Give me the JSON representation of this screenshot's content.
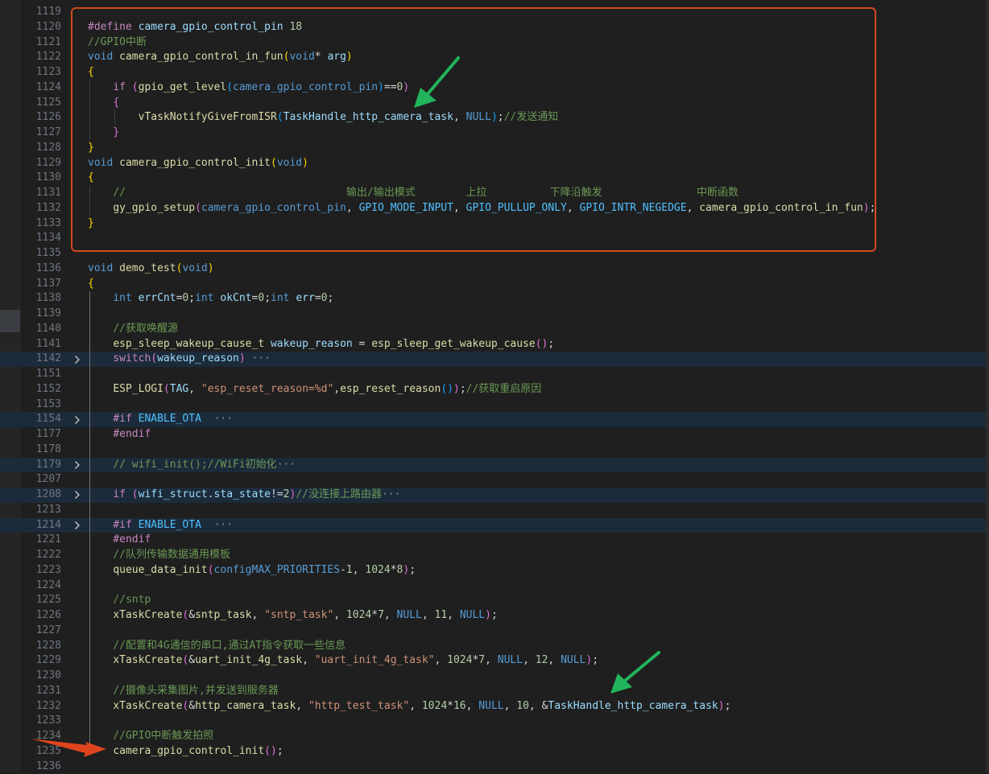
{
  "editor": {
    "language": "c",
    "highlight_box_color": "#d04a1e",
    "arrow_colors": {
      "green": "#22b45c",
      "red": "#e0441c"
    },
    "lines": [
      {
        "n": "1119",
        "tokens": []
      },
      {
        "n": "1120",
        "tokens": [
          {
            "t": "#define",
            "c": "kc"
          },
          {
            "t": " camera_gpio_control_pin ",
            "c": "v"
          },
          {
            "t": "18",
            "c": "n"
          }
        ]
      },
      {
        "n": "1121",
        "tokens": [
          {
            "t": "//GPIO中断",
            "c": "c"
          }
        ]
      },
      {
        "n": "1122",
        "tokens": [
          {
            "t": "void",
            "c": "k"
          },
          {
            "t": " "
          },
          {
            "t": "camera_gpio_control_in_fun",
            "c": "fn"
          },
          {
            "t": "(",
            "c": "b1"
          },
          {
            "t": "void",
            "c": "k"
          },
          {
            "t": "* "
          },
          {
            "t": "arg",
            "c": "v"
          },
          {
            "t": ")",
            "c": "b1"
          }
        ]
      },
      {
        "n": "1123",
        "tokens": [
          {
            "t": "{",
            "c": "b1"
          }
        ]
      },
      {
        "n": "1124",
        "tokens": [
          {
            "t": "    "
          },
          {
            "t": "if",
            "c": "kc"
          },
          {
            "t": " "
          },
          {
            "t": "(",
            "c": "b2"
          },
          {
            "t": "gpio_get_level",
            "c": "fn"
          },
          {
            "t": "(",
            "c": "b3"
          },
          {
            "t": "camera_gpio_control_pin",
            "c": "k"
          },
          {
            "t": ")",
            "c": "b3"
          },
          {
            "t": "=="
          },
          {
            "t": "0",
            "c": "n"
          },
          {
            "t": ")",
            "c": "b2"
          }
        ]
      },
      {
        "n": "1125",
        "tokens": [
          {
            "t": "    "
          },
          {
            "t": "{",
            "c": "b2"
          }
        ]
      },
      {
        "n": "1126",
        "tokens": [
          {
            "t": "        "
          },
          {
            "t": "vTaskNotifyGiveFromISR",
            "c": "fn"
          },
          {
            "t": "(",
            "c": "b3"
          },
          {
            "t": "TaskHandle_http_camera_task",
            "c": "v"
          },
          {
            "t": ", "
          },
          {
            "t": "NULL",
            "c": "k"
          },
          {
            "t": ")",
            "c": "b3"
          },
          {
            "t": ";"
          },
          {
            "t": "//发送通知",
            "c": "c"
          }
        ]
      },
      {
        "n": "1127",
        "tokens": [
          {
            "t": "    "
          },
          {
            "t": "}",
            "c": "b2"
          }
        ]
      },
      {
        "n": "1128",
        "tokens": [
          {
            "t": "}",
            "c": "b1"
          }
        ]
      },
      {
        "n": "1129",
        "tokens": [
          {
            "t": "void",
            "c": "k"
          },
          {
            "t": " "
          },
          {
            "t": "camera_gpio_control_init",
            "c": "fn"
          },
          {
            "t": "(",
            "c": "b1"
          },
          {
            "t": "void",
            "c": "k"
          },
          {
            "t": ")",
            "c": "b1"
          }
        ]
      },
      {
        "n": "1130",
        "tokens": [
          {
            "t": "{",
            "c": "b1"
          }
        ]
      },
      {
        "n": "1131",
        "tokens": [
          {
            "t": "    "
          },
          {
            "t": "//                                   输出/输出模式        上拉          下降沿触发               中断函数",
            "c": "c"
          }
        ]
      },
      {
        "n": "1132",
        "tokens": [
          {
            "t": "    "
          },
          {
            "t": "gy_gpio_setup",
            "c": "fn"
          },
          {
            "t": "(",
            "c": "b2"
          },
          {
            "t": "camera_gpio_control_pin",
            "c": "k"
          },
          {
            "t": ", "
          },
          {
            "t": "GPIO_MODE_INPUT",
            "c": "m"
          },
          {
            "t": ", "
          },
          {
            "t": "GPIO_PULLUP_ONLY",
            "c": "m"
          },
          {
            "t": ", "
          },
          {
            "t": "GPIO_INTR_NEGEDGE",
            "c": "m"
          },
          {
            "t": ", "
          },
          {
            "t": "camera_gpio_control_in_fun",
            "c": "fn"
          },
          {
            "t": ")",
            "c": "b2"
          },
          {
            "t": ";"
          }
        ]
      },
      {
        "n": "1133",
        "tokens": [
          {
            "t": "}",
            "c": "b1"
          }
        ]
      },
      {
        "n": "1134",
        "tokens": []
      },
      {
        "n": "1135",
        "tokens": []
      },
      {
        "n": "1136",
        "tokens": [
          {
            "t": "void",
            "c": "k"
          },
          {
            "t": " "
          },
          {
            "t": "demo_test",
            "c": "fn"
          },
          {
            "t": "(",
            "c": "b1"
          },
          {
            "t": "void",
            "c": "k"
          },
          {
            "t": ")",
            "c": "b1"
          }
        ]
      },
      {
        "n": "1137",
        "tokens": [
          {
            "t": "{",
            "c": "b1"
          }
        ]
      },
      {
        "n": "1138",
        "tokens": [
          {
            "t": "    "
          },
          {
            "t": "int",
            "c": "k"
          },
          {
            "t": " "
          },
          {
            "t": "errCnt",
            "c": "v"
          },
          {
            "t": "="
          },
          {
            "t": "0",
            "c": "n"
          },
          {
            "t": ";"
          },
          {
            "t": "int",
            "c": "k"
          },
          {
            "t": " "
          },
          {
            "t": "okCnt",
            "c": "v"
          },
          {
            "t": "="
          },
          {
            "t": "0",
            "c": "n"
          },
          {
            "t": ";"
          },
          {
            "t": "int",
            "c": "k"
          },
          {
            "t": " "
          },
          {
            "t": "err",
            "c": "v"
          },
          {
            "t": "="
          },
          {
            "t": "0",
            "c": "n"
          },
          {
            "t": ";"
          }
        ]
      },
      {
        "n": "1139",
        "tokens": []
      },
      {
        "n": "1140",
        "tokens": [
          {
            "t": "    "
          },
          {
            "t": "//获取唤醒源",
            "c": "c"
          }
        ]
      },
      {
        "n": "1141",
        "tokens": [
          {
            "t": "    "
          },
          {
            "t": "esp_sleep_wakeup_cause_t",
            "c": "fn"
          },
          {
            "t": " "
          },
          {
            "t": "wakeup_reason",
            "c": "v"
          },
          {
            "t": " = "
          },
          {
            "t": "esp_sleep_get_wakeup_cause",
            "c": "fn"
          },
          {
            "t": "(",
            "c": "b2"
          },
          {
            "t": ")",
            "c": "b2"
          },
          {
            "t": ";"
          }
        ]
      },
      {
        "n": "1142",
        "fold": true,
        "tokens": [
          {
            "t": "    "
          },
          {
            "t": "switch",
            "c": "kc"
          },
          {
            "t": "(",
            "c": "b2"
          },
          {
            "t": "wakeup_reason",
            "c": "v"
          },
          {
            "t": ")",
            "c": "b2"
          },
          {
            "t": " "
          },
          {
            "t": "···",
            "c": "el"
          }
        ]
      },
      {
        "n": "1151",
        "tokens": []
      },
      {
        "n": "1152",
        "tokens": [
          {
            "t": "    "
          },
          {
            "t": "ESP_LOGI",
            "c": "fn"
          },
          {
            "t": "(",
            "c": "b2"
          },
          {
            "t": "TAG",
            "c": "v"
          },
          {
            "t": ", "
          },
          {
            "t": "\"esp_reset_reason=%d\"",
            "c": "s"
          },
          {
            "t": ","
          },
          {
            "t": "esp_reset_reason",
            "c": "fn"
          },
          {
            "t": "(",
            "c": "b3"
          },
          {
            "t": ")",
            "c": "b3"
          },
          {
            "t": ")",
            "c": "b2"
          },
          {
            "t": ";"
          },
          {
            "t": "//获取重启原因",
            "c": "c"
          }
        ]
      },
      {
        "n": "1153",
        "tokens": []
      },
      {
        "n": "1154",
        "fold": true,
        "tokens": [
          {
            "t": "    "
          },
          {
            "t": "#if",
            "c": "kc"
          },
          {
            "t": " "
          },
          {
            "t": "ENABLE_OTA",
            "c": "m"
          },
          {
            "t": "  "
          },
          {
            "t": "···",
            "c": "el"
          }
        ]
      },
      {
        "n": "1177",
        "tokens": [
          {
            "t": "    "
          },
          {
            "t": "#endif",
            "c": "kc"
          }
        ]
      },
      {
        "n": "1178",
        "tokens": []
      },
      {
        "n": "1179",
        "fold": true,
        "tokens": [
          {
            "t": "    "
          },
          {
            "t": "// wifi_init();//WiFi初始化",
            "c": "c"
          },
          {
            "t": "···",
            "c": "el"
          }
        ]
      },
      {
        "n": "1207",
        "tokens": []
      },
      {
        "n": "1208",
        "fold": true,
        "tokens": [
          {
            "t": "    "
          },
          {
            "t": "if",
            "c": "kc"
          },
          {
            "t": " "
          },
          {
            "t": "(",
            "c": "b2"
          },
          {
            "t": "wifi_struct",
            "c": "v"
          },
          {
            "t": "."
          },
          {
            "t": "sta_state",
            "c": "v"
          },
          {
            "t": "!="
          },
          {
            "t": "2",
            "c": "n"
          },
          {
            "t": ")",
            "c": "b2"
          },
          {
            "t": "//没连接上路由器",
            "c": "c"
          },
          {
            "t": "···",
            "c": "el"
          }
        ]
      },
      {
        "n": "1213",
        "tokens": []
      },
      {
        "n": "1214",
        "fold": true,
        "tokens": [
          {
            "t": "    "
          },
          {
            "t": "#if",
            "c": "kc"
          },
          {
            "t": " "
          },
          {
            "t": "ENABLE_OTA",
            "c": "m"
          },
          {
            "t": "  "
          },
          {
            "t": "···",
            "c": "el"
          }
        ]
      },
      {
        "n": "1221",
        "tokens": [
          {
            "t": "    "
          },
          {
            "t": "#endif",
            "c": "kc"
          }
        ]
      },
      {
        "n": "1222",
        "tokens": [
          {
            "t": "    "
          },
          {
            "t": "//队列传输数据通用模板",
            "c": "c"
          }
        ]
      },
      {
        "n": "1223",
        "tokens": [
          {
            "t": "    "
          },
          {
            "t": "queue_data_init",
            "c": "fn"
          },
          {
            "t": "(",
            "c": "b2"
          },
          {
            "t": "configMAX_PRIORITIES",
            "c": "k"
          },
          {
            "t": "-"
          },
          {
            "t": "1",
            "c": "n"
          },
          {
            "t": ", "
          },
          {
            "t": "1024",
            "c": "n"
          },
          {
            "t": "*"
          },
          {
            "t": "8",
            "c": "n"
          },
          {
            "t": ")",
            "c": "b2"
          },
          {
            "t": ";"
          }
        ]
      },
      {
        "n": "1224",
        "tokens": []
      },
      {
        "n": "1225",
        "tokens": [
          {
            "t": "    "
          },
          {
            "t": "//sntp",
            "c": "c"
          }
        ]
      },
      {
        "n": "1226",
        "tokens": [
          {
            "t": "    "
          },
          {
            "t": "xTaskCreate",
            "c": "fn"
          },
          {
            "t": "(",
            "c": "b2"
          },
          {
            "t": "&"
          },
          {
            "t": "sntp_task",
            "c": "fn"
          },
          {
            "t": ", "
          },
          {
            "t": "\"sntp_task\"",
            "c": "s"
          },
          {
            "t": ", "
          },
          {
            "t": "1024",
            "c": "n"
          },
          {
            "t": "*"
          },
          {
            "t": "7",
            "c": "n"
          },
          {
            "t": ", "
          },
          {
            "t": "NULL",
            "c": "k"
          },
          {
            "t": ", "
          },
          {
            "t": "11",
            "c": "n"
          },
          {
            "t": ", "
          },
          {
            "t": "NULL",
            "c": "k"
          },
          {
            "t": ")",
            "c": "b2"
          },
          {
            "t": ";"
          }
        ]
      },
      {
        "n": "1227",
        "tokens": []
      },
      {
        "n": "1228",
        "tokens": [
          {
            "t": "    "
          },
          {
            "t": "//配置和4G通信的串口,通过AT指令获取一些信息",
            "c": "c"
          }
        ]
      },
      {
        "n": "1229",
        "tokens": [
          {
            "t": "    "
          },
          {
            "t": "xTaskCreate",
            "c": "fn"
          },
          {
            "t": "(",
            "c": "b2"
          },
          {
            "t": "&"
          },
          {
            "t": "uart_init_4g_task",
            "c": "fn"
          },
          {
            "t": ", "
          },
          {
            "t": "\"uart_init_4g_task\"",
            "c": "s"
          },
          {
            "t": ", "
          },
          {
            "t": "1024",
            "c": "n"
          },
          {
            "t": "*"
          },
          {
            "t": "7",
            "c": "n"
          },
          {
            "t": ", "
          },
          {
            "t": "NULL",
            "c": "k"
          },
          {
            "t": ", "
          },
          {
            "t": "12",
            "c": "n"
          },
          {
            "t": ", "
          },
          {
            "t": "NULL",
            "c": "k"
          },
          {
            "t": ")",
            "c": "b2"
          },
          {
            "t": ";"
          }
        ]
      },
      {
        "n": "1230",
        "tokens": []
      },
      {
        "n": "1231",
        "tokens": [
          {
            "t": "    "
          },
          {
            "t": "//摄像头采集图片,并发送到服务器",
            "c": "c"
          }
        ]
      },
      {
        "n": "1232",
        "tokens": [
          {
            "t": "    "
          },
          {
            "t": "xTaskCreate",
            "c": "fn"
          },
          {
            "t": "(",
            "c": "b2"
          },
          {
            "t": "&"
          },
          {
            "t": "http_camera_task",
            "c": "fn"
          },
          {
            "t": ", "
          },
          {
            "t": "\"http_test_task\"",
            "c": "s"
          },
          {
            "t": ", "
          },
          {
            "t": "1024",
            "c": "n"
          },
          {
            "t": "*"
          },
          {
            "t": "16",
            "c": "n"
          },
          {
            "t": ", "
          },
          {
            "t": "NULL",
            "c": "k"
          },
          {
            "t": ", "
          },
          {
            "t": "10",
            "c": "n"
          },
          {
            "t": ", "
          },
          {
            "t": "&"
          },
          {
            "t": "TaskHandle_http_camera_task",
            "c": "v"
          },
          {
            "t": ")",
            "c": "b2"
          },
          {
            "t": ";"
          }
        ]
      },
      {
        "n": "1233",
        "tokens": []
      },
      {
        "n": "1234",
        "tokens": [
          {
            "t": "    "
          },
          {
            "t": "//GPIO中断触发拍照",
            "c": "c"
          }
        ]
      },
      {
        "n": "1235",
        "tokens": [
          {
            "t": "    "
          },
          {
            "t": "camera_gpio_control_init",
            "c": "fn"
          },
          {
            "t": "(",
            "c": "b2"
          },
          {
            "t": ")",
            "c": "b2"
          },
          {
            "t": ";"
          }
        ]
      },
      {
        "n": "1236",
        "tokens": []
      }
    ]
  }
}
